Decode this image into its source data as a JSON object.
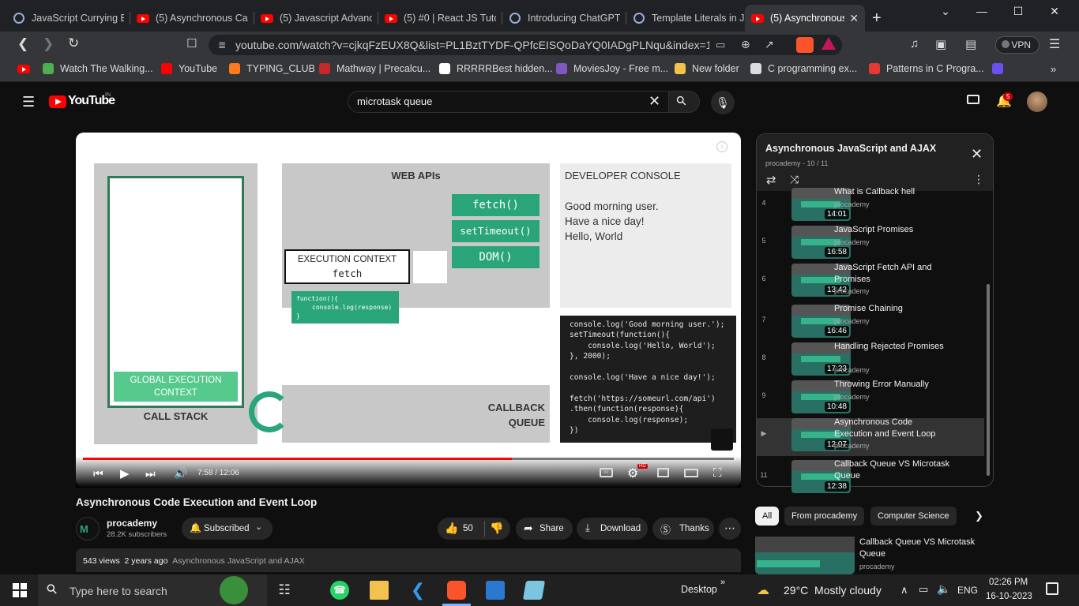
{
  "tabs": [
    {
      "label": "JavaScript Currying Ex",
      "icon": "chatgpt-icon"
    },
    {
      "label": "(5) Asynchronous Call",
      "icon": "youtube-icon"
    },
    {
      "label": "(5) Javascript Advance",
      "icon": "youtube-icon"
    },
    {
      "label": "(5) #0 | React JS Tutori",
      "icon": "youtube-icon"
    },
    {
      "label": "Introducing ChatGPT",
      "icon": "chatgpt-icon"
    },
    {
      "label": "Template Literals in Ja",
      "icon": "chatgpt-icon"
    },
    {
      "label": "(5) Asynchronous",
      "icon": "youtube-icon",
      "active": true
    }
  ],
  "address": {
    "url": "youtube.com/watch?v=cjkqFzEUX8Q&list=PL1BztTYDF-QPfcEISQoDaYQ0IADgPLNqu&index=10"
  },
  "toolbar": {
    "vpn_label": "VPN"
  },
  "bookmarks": [
    "Watch The Walking...",
    "YouTube",
    "TYPING_CLUB",
    "Mathway | Precalcu...",
    "RRRRRBest hidden...",
    "MoviesJoy - Free m...",
    "New folder",
    "C programming ex...",
    "Patterns in C Progra..."
  ],
  "yt": {
    "logo": "YouTube",
    "region": "IN",
    "search_value": "microtask queue",
    "notif_count": "5"
  },
  "slide": {
    "web_apis": "WEB APIs",
    "fetch": "fetch()",
    "settimeout": "setTimeout()",
    "dom": "DOM()",
    "exec_ctx_title": "EXECUTION CONTEXT",
    "exec_ctx_name": "fetch",
    "callback_fn_l1": "function(){",
    "callback_fn_l2": "console.log(response)",
    "callback_fn_l3": "}",
    "global_ctx": "GLOBAL EXECUTION CONTEXT",
    "call_stack": "CALL STACK",
    "callback_queue": "CALLBACK QUEUE",
    "dev_console": "DEVELOPER CONSOLE",
    "console_lines": [
      "Good morning user.",
      "Have a nice day!",
      "Hello, World"
    ],
    "code_lines": [
      "console.log('Good morning user.');",
      "setTimeout(function(){",
      "    console.log('Hello, World');",
      "}, 2000);",
      "",
      "console.log('Have a nice day!');",
      "",
      "fetch('https://someurl.com/api')",
      ".then(function(response){",
      "    console.log(response);",
      "})"
    ]
  },
  "player": {
    "time": "7:58 / 12:06",
    "progress": 0.659,
    "quality_badge": "HD"
  },
  "video": {
    "title": "Asynchronous Code Execution and Event Loop",
    "channel": "procademy",
    "subscribers": "28.2K subscribers",
    "subscribed_label": "Subscribed",
    "likes": "50",
    "share": "Share",
    "download": "Download",
    "thanks": "Thanks",
    "views": "543 views",
    "age": "2 years ago",
    "playlist_tag": "Asynchronous JavaScript and AJAX"
  },
  "playlist": {
    "title": "Asynchronous JavaScript and AJAX",
    "meta": "procademy - 10 / 11",
    "items": [
      {
        "num": "4",
        "title": "What is Callback hell",
        "channel": "procademy",
        "duration": "14:01"
      },
      {
        "num": "5",
        "title": "JavaScript Promises",
        "channel": "procademy",
        "duration": "16:58"
      },
      {
        "num": "6",
        "title": "JavaScript Fetch API and Promises",
        "channel": "procademy",
        "duration": "13:42"
      },
      {
        "num": "7",
        "title": "Promise Chaining",
        "channel": "procademy",
        "duration": "16:46"
      },
      {
        "num": "8",
        "title": "Handling Rejected Promises",
        "channel": "procademy",
        "duration": "17:23"
      },
      {
        "num": "9",
        "title": "Throwing Error Manually",
        "channel": "procademy",
        "duration": "10:48"
      },
      {
        "num": "▶",
        "title": "Asynchronous Code Execution and Event Loop",
        "channel": "procademy",
        "duration": "12:07",
        "active": true
      },
      {
        "num": "11",
        "title": "Callback Queue VS Microtask Queue",
        "channel": "",
        "duration": "12:38"
      }
    ]
  },
  "chips": [
    "All",
    "From procademy",
    "Computer Science"
  ],
  "recommended": {
    "title": "Callback Queue VS Microtask Queue",
    "channel": "procademy"
  },
  "taskbar": {
    "search_placeholder": "Type here to search",
    "desktop": "Desktop",
    "weather": "29°C  Mostly cloudy",
    "lang": "ENG",
    "time": "02:26 PM",
    "date": "16-10-2023"
  }
}
